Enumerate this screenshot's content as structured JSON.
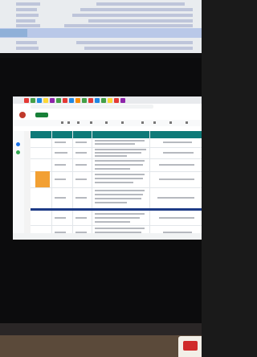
{
  "scene": {
    "description_hidden": "",
    "browser": {
      "url": "",
      "share_label": ""
    },
    "colors": {
      "sheet_header": "#0e7a78",
      "highlight_orange": "#f2a033",
      "band_navy": "#1d3b86",
      "share_green": "#188038"
    }
  }
}
